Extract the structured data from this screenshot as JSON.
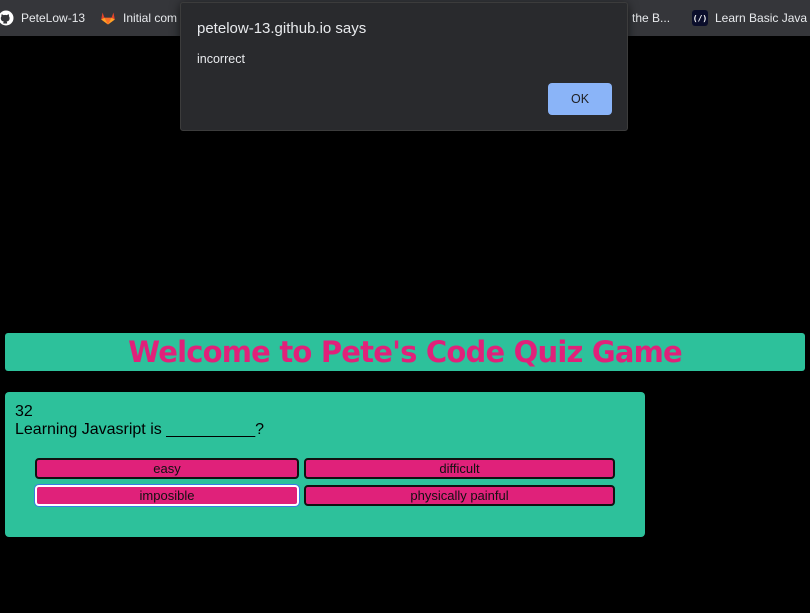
{
  "bookmarks": {
    "items": [
      {
        "label": "PeteLow-13",
        "icon": "github-icon"
      },
      {
        "label": "Initial com",
        "icon": "gitlab-icon"
      },
      {
        "label": "the B...",
        "icon": ""
      },
      {
        "label": "Learn Basic Java",
        "icon": "codecademy-icon"
      }
    ]
  },
  "alert": {
    "title": "petelow-13.github.io says",
    "message": "incorrect",
    "ok_label": "OK"
  },
  "header": {
    "title": "Welcome to Pete's Code Quiz Game"
  },
  "quiz": {
    "timer": "32",
    "question": "Learning Javasript is __________?",
    "answers": [
      "easy",
      "difficult",
      "imposible",
      "physically painful"
    ]
  },
  "colors": {
    "accent_teal": "#2dc19b",
    "accent_pink": "#e0217a",
    "dialog_bg": "#292a2d",
    "ok_button": "#8ab4f8"
  }
}
